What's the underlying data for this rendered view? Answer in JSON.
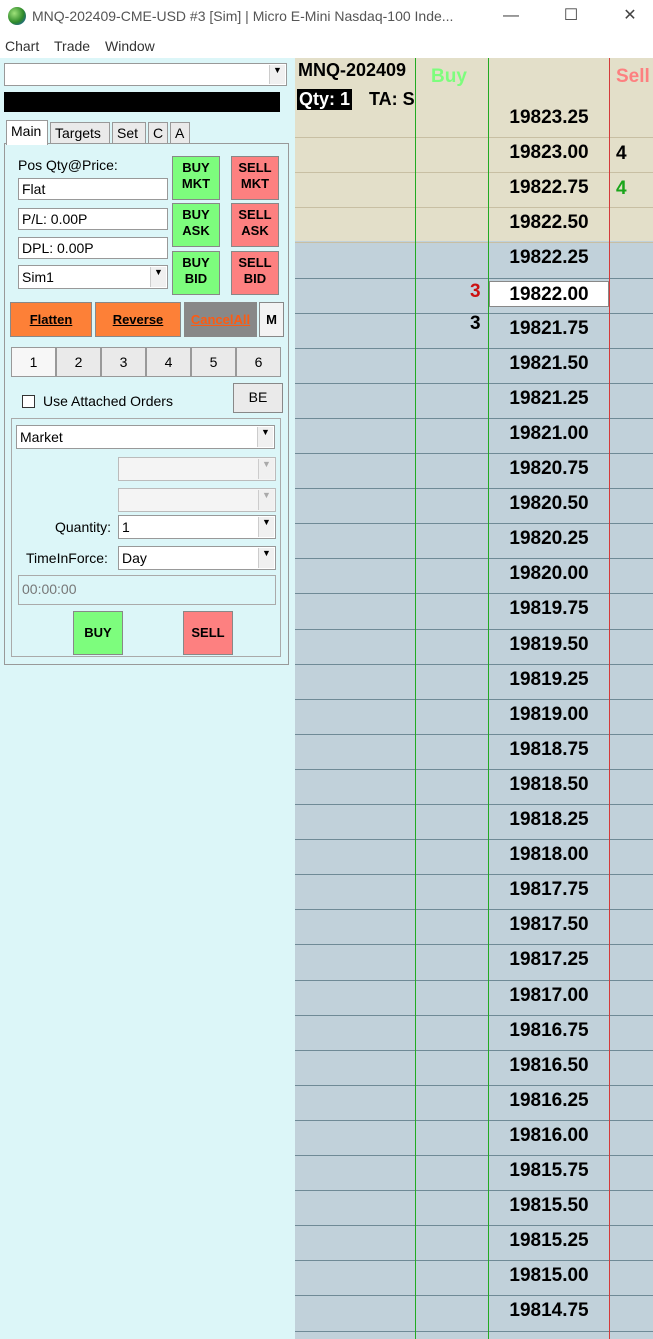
{
  "window": {
    "title": "MNQ-202409-CME-USD #3 [Sim]  | Micro E-Mini Nasdaq-100 Inde...",
    "minimize_glyph": "—",
    "maximize_glyph": "☐",
    "close_glyph": "✕"
  },
  "menu": [
    "Chart",
    "Trade",
    "Window"
  ],
  "panel": {
    "account_combo_value": "",
    "tabs": [
      "Main",
      "Targets",
      "Set",
      "C",
      "A"
    ],
    "pos_label": "Pos Qty@Price:",
    "pos_value": "Flat",
    "pl_value": "P/L: 0.00P",
    "dpl_value": "DPL: 0.00P",
    "account": "Sim1",
    "buy_mkt": [
      "BUY",
      "MKT"
    ],
    "sell_mkt": [
      "SELL",
      "MKT"
    ],
    "buy_ask": [
      "BUY",
      "ASK"
    ],
    "sell_ask": [
      "SELL",
      "ASK"
    ],
    "buy_bid": [
      "BUY",
      "BID"
    ],
    "sell_bid": [
      "SELL",
      "BID"
    ],
    "flatten": "Flatten",
    "reverse": "Reverse",
    "cancel_all": "CancelAll",
    "m_button": "M",
    "quick_numbers": [
      "1",
      "2",
      "3",
      "4",
      "5",
      "6"
    ],
    "use_attached_orders": "Use Attached Orders",
    "use_attached_checked": false,
    "be_button": "BE",
    "order_type": "Market",
    "quantity_label": "Quantity:",
    "quantity": "1",
    "tif_label": "TimeInForce:",
    "tif": "Day",
    "time_field": "00:00:00",
    "buy_button": "BUY",
    "sell_button": "SELL"
  },
  "ladder": {
    "symbol": "MNQ-202409",
    "qty_label": "Qty: 1",
    "ta_label": "TA: S",
    "buy_header": "Buy",
    "sell_header": "Sell",
    "current_price": "19822.00",
    "prices": [
      "19823.25",
      "19823.00",
      "19822.75",
      "19822.50",
      "19822.25",
      "19822.00",
      "19821.75",
      "19821.50",
      "19821.25",
      "19821.00",
      "19820.75",
      "19820.50",
      "19820.25",
      "19820.00",
      "19819.75",
      "19819.50",
      "19819.25",
      "19819.00",
      "19818.75",
      "19818.50",
      "19818.25",
      "19818.00",
      "19817.75",
      "19817.50",
      "19817.25",
      "19817.00",
      "19816.75",
      "19816.50",
      "19816.25",
      "19816.00",
      "19815.75",
      "19815.50",
      "19815.25",
      "19815.00",
      "19814.75"
    ],
    "sell_qty": [
      {
        "price_index": 1,
        "value": "4",
        "color": "#000000"
      },
      {
        "price_index": 2,
        "value": "4",
        "color": "#1aa51a"
      }
    ],
    "buy_side_qty": [
      {
        "price_index": 5,
        "value": "3",
        "color": "#cc1111"
      },
      {
        "price_index": 6,
        "value": "3",
        "color": "#000000"
      }
    ]
  },
  "colors": {
    "left_bg": "#dcf6f8",
    "ladder_bg": "#c1d1da",
    "ladder_header_bg": "#e3dfc9",
    "buy_green": "#7dfd7d",
    "sell_red": "#fd8080",
    "orange": "#fd8037",
    "buy_line": "#22aa22",
    "sell_line": "#d43a3a"
  }
}
